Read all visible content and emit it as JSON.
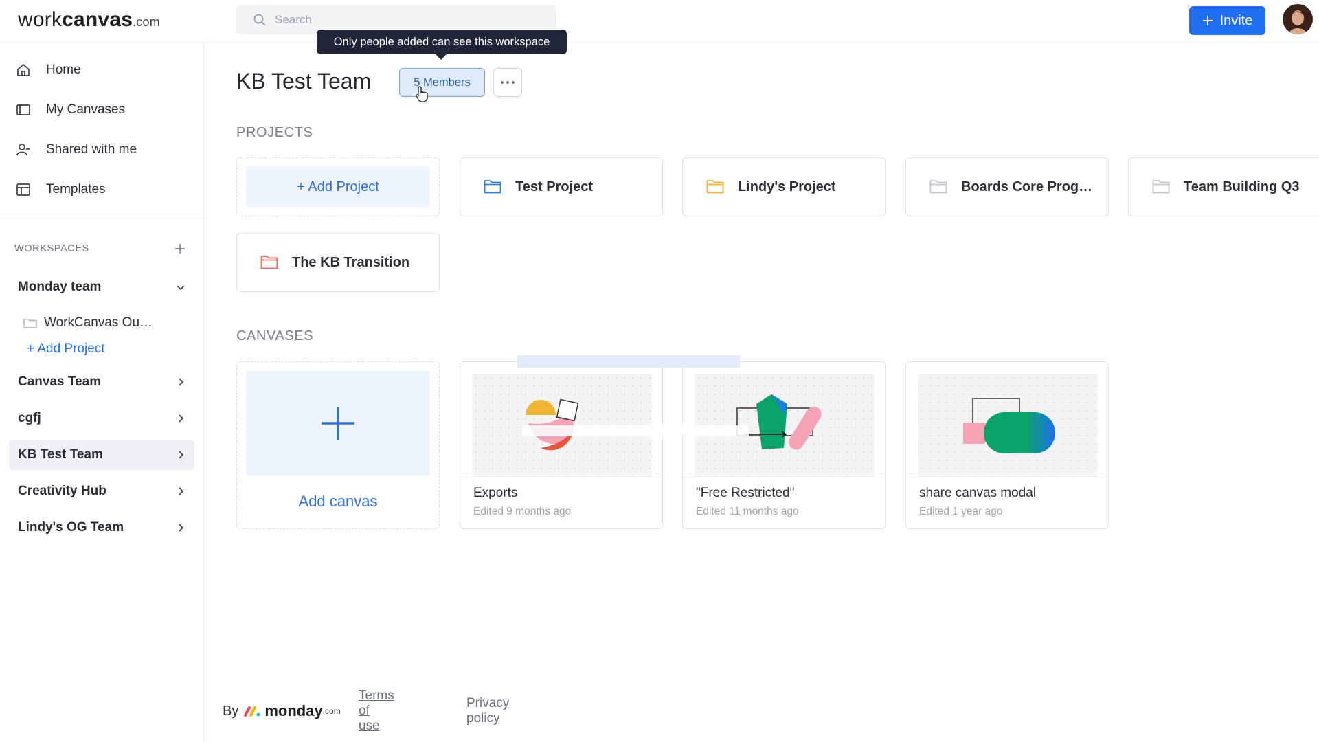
{
  "app": {
    "logo_part1": "work",
    "logo_part2": "canvas",
    "logo_part3": ".com",
    "search_placeholder": "Search",
    "invite_label": "Invite",
    "accent_color": "#1f6ff0"
  },
  "sidebar": {
    "nav": [
      {
        "label": "Home",
        "icon": "home-icon"
      },
      {
        "label": "My Canvases",
        "icon": "canvas-icon"
      },
      {
        "label": "Shared with me",
        "icon": "user-share-icon"
      },
      {
        "label": "Templates",
        "icon": "template-icon"
      }
    ],
    "workspaces_header": "WORKSPACES",
    "workspaces": [
      {
        "label": "Monday team",
        "expanded": true
      },
      {
        "label": "Canvas Team"
      },
      {
        "label": "cgfj"
      },
      {
        "label": "KB Test Team",
        "active": true
      },
      {
        "label": "Creativity Hub"
      },
      {
        "label": "Lindy's OG Team"
      }
    ],
    "monday_sub_item": "WorkCanvas Ou…",
    "add_project_label": "+ Add Project"
  },
  "main": {
    "title": "KB Test Team",
    "members_label": "5 Members",
    "tooltip": "Only people added can see this workspace",
    "projects_title": "PROJECTS",
    "add_project_label": "+ Add Project",
    "projects": [
      {
        "name": "Test Project",
        "folder_color": "#2f7fd8"
      },
      {
        "name": "Lindy's Project",
        "folder_color": "#f2b33d"
      },
      {
        "name": "Boards Core Prog…",
        "folder_color": "#c4c7ce"
      },
      {
        "name": "Team Building Q3",
        "folder_color": "#c4c7ce"
      },
      {
        "name": "The KB Transition",
        "folder_color": "#e8665a"
      }
    ],
    "canvases_title": "CANVASES",
    "add_canvas_label": "Add canvas",
    "canvases": [
      {
        "name": "Exports",
        "edited": "Edited 9 months ago"
      },
      {
        "name": "\"Free Restricted\"",
        "edited": "Edited 11 months ago"
      },
      {
        "name": "share canvas modal",
        "edited": "Edited 1 year ago"
      }
    ]
  },
  "footer": {
    "by": "By",
    "brand": "monday",
    "brand_suffix": ".com",
    "terms": "Terms of use",
    "privacy": "Privacy policy"
  }
}
